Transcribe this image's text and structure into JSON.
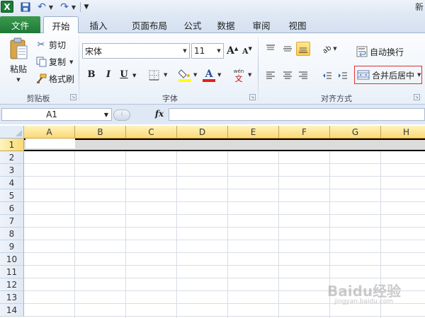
{
  "title_partial": "新",
  "qat": {
    "logo": "X"
  },
  "tabs": {
    "file": "文件",
    "home": "开始",
    "insert": "插入",
    "layout": "页面布局",
    "formula": "公式",
    "data": "数据",
    "review": "审阅",
    "view": "视图"
  },
  "ribbon": {
    "clipboard": {
      "group": "剪贴板",
      "paste": "粘贴",
      "cut": "剪切",
      "copy": "复制",
      "painter": "格式刷"
    },
    "font": {
      "group": "字体",
      "name": "宋体",
      "size": "11",
      "bold": "B",
      "italic": "I",
      "underline": "U",
      "grow": "A",
      "shrink": "A",
      "fill_color": "#ffff00",
      "font_color": "#e0201b",
      "phonetic": "wén"
    },
    "alignment": {
      "group": "对齐方式",
      "wrap_text": "自动换行",
      "merge_center": "合并后居中"
    }
  },
  "formula_bar": {
    "name_box": "A1",
    "fx": "fx",
    "value": ""
  },
  "grid": {
    "columns": [
      "A",
      "B",
      "C",
      "D",
      "E",
      "F",
      "G",
      "H"
    ],
    "rows": [
      "1",
      "2",
      "3",
      "4",
      "5",
      "6",
      "7",
      "8",
      "9",
      "10",
      "11",
      "12",
      "13",
      "14"
    ],
    "active_cell": "A1",
    "selected_row": "1"
  },
  "watermark": {
    "text": "Baidu经验",
    "sub": "jingyan.baidu.com"
  },
  "colors": {
    "file_tab": "#1e7a37",
    "selection_header": "#fbd975",
    "merge_highlight": "#e03030"
  }
}
